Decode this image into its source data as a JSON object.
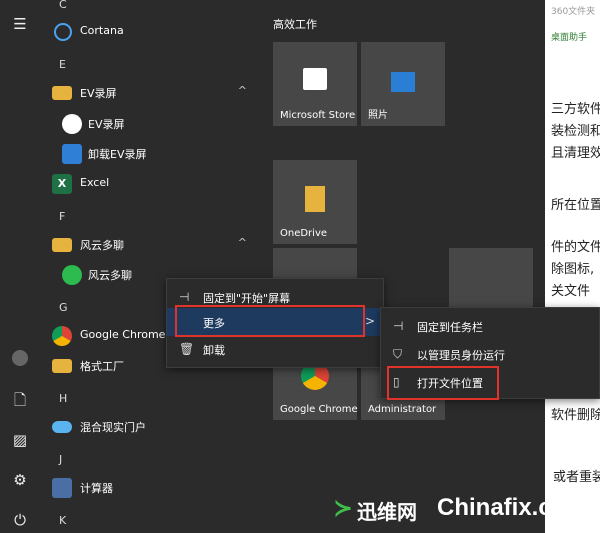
{
  "background_doc": {
    "lines": [
      "360文件夹",
      "桌面助手",
      "三方软件",
      "装检测和",
      "且清理效",
      "所在位置,",
      "件的文件",
      "除图标,",
      "关文件",
      "软件删除",
      "或者重装"
    ]
  },
  "rail": {
    "icons": [
      "hamburger-icon",
      "user-avatar-icon",
      "document-icon",
      "pictures-icon",
      "settings-icon",
      "power-icon"
    ]
  },
  "applist": {
    "letters": [
      "C",
      "E",
      "F",
      "G",
      "H",
      "J",
      "K"
    ],
    "apps": [
      {
        "label": "Cortana"
      },
      {
        "label": "EV录屏"
      },
      {
        "label": "EV录屏"
      },
      {
        "label": "卸载EV录屏"
      },
      {
        "label": "Excel"
      },
      {
        "label": "风云多聊"
      },
      {
        "label": "风云多聊"
      },
      {
        "label": "Google Chrome"
      },
      {
        "label": "格式工厂"
      },
      {
        "label": "混合现实门户"
      },
      {
        "label": "计算器"
      }
    ]
  },
  "tiles": {
    "group_title": "高效工作",
    "items": [
      {
        "label": "Microsoft Store"
      },
      {
        "label": "照片"
      },
      {
        "label": "OneDrive"
      },
      {
        "label": "Google Chrome"
      },
      {
        "label": "Administrator"
      }
    ]
  },
  "context_menu": {
    "items": [
      {
        "label": "固定到\"开始\"屏幕",
        "icon": "pin-icon"
      },
      {
        "label": "更多",
        "icon": ""
      },
      {
        "label": "卸载",
        "icon": "trash-icon"
      }
    ]
  },
  "submenu": {
    "items": [
      {
        "label": "固定到任务栏",
        "icon": "pin-icon"
      },
      {
        "label": "以管理员身份运行",
        "icon": "shield-icon"
      },
      {
        "label": "打开文件位置",
        "icon": "file-icon"
      }
    ]
  },
  "watermark": {
    "text_cn": "迅维网",
    "text_en": "Chinafix.com"
  },
  "colors": {
    "highlight_border": "#e0342a",
    "menu_selected": "#1e3a5f"
  }
}
